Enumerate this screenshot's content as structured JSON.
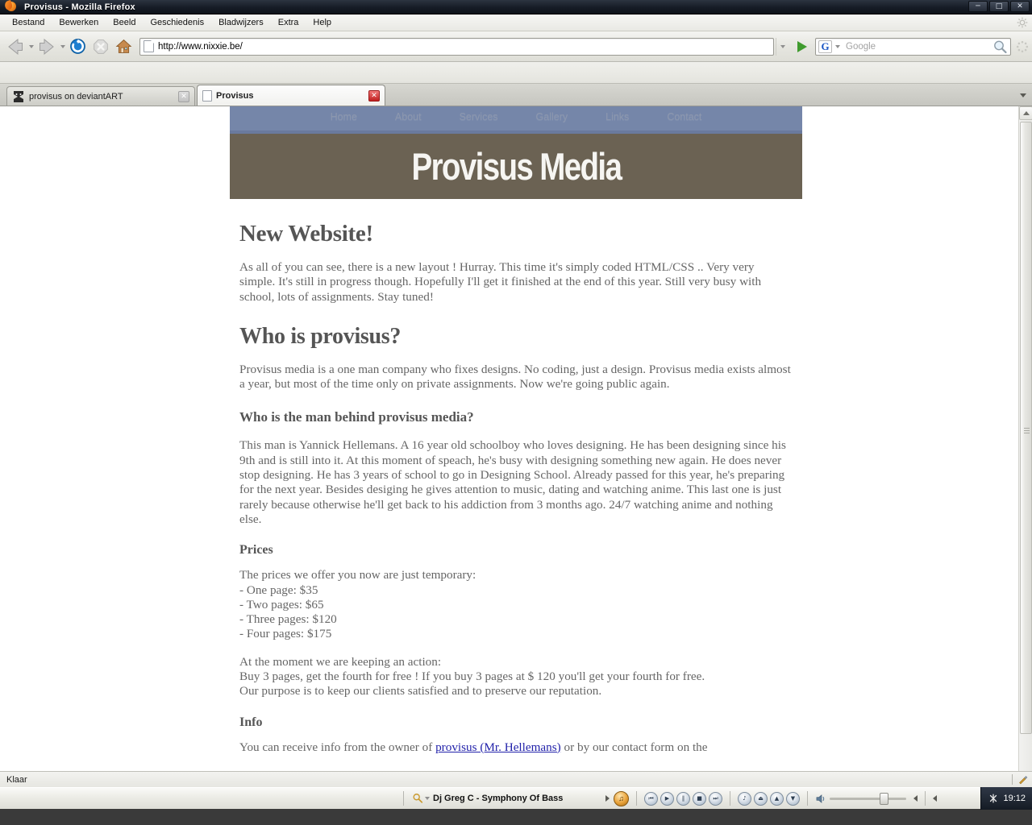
{
  "browser": {
    "window_title": "Provisus - Mozilla Firefox",
    "window_controls": {
      "minimize": "─",
      "maximize": "□",
      "close": "✕"
    },
    "menu": [
      {
        "label": "Bestand",
        "accel": "B"
      },
      {
        "label": "Bewerken",
        "accel": "w"
      },
      {
        "label": "Beeld",
        "accel": "l"
      },
      {
        "label": "Geschiedenis",
        "accel": "G"
      },
      {
        "label": "Bladwijzers",
        "accel": "d"
      },
      {
        "label": "Extra",
        "accel": "x"
      },
      {
        "label": "Help",
        "accel": "H"
      }
    ],
    "toolbar": {
      "back_label": "Back",
      "forward_label": "Forward",
      "reload_label": "Reload",
      "stop_label": "Stop",
      "home_label": "Home",
      "url_value": "http://www.nixxie.be/",
      "url_placeholder": "",
      "go_label": "Go",
      "search_placeholder": "Google",
      "search_value": "",
      "search_engine": "G"
    },
    "tabs": [
      {
        "label": "provisus on deviantART",
        "icon": "deviantart-icon",
        "active": false,
        "close": "✕"
      },
      {
        "label": "Provisus",
        "icon": "page-icon",
        "active": true,
        "close": "✕"
      }
    ],
    "status": {
      "text": "Klaar"
    }
  },
  "site": {
    "nav": [
      {
        "label": "Home"
      },
      {
        "label": "About"
      },
      {
        "label": "Services"
      },
      {
        "label": "Gallery"
      },
      {
        "label": "Links"
      },
      {
        "label": "Contact"
      }
    ],
    "title": "Provisus Media",
    "sections": {
      "h1": "New Website!",
      "intro": "As all of you can see, there is a new layout ! Hurray. This time it's simply coded HTML/CSS .. Very very simple. It's still in progress though. Hopefully I'll get it finished at the end of this year. Still very busy with school, lots of assignments. Stay tuned!",
      "h2_who": "Who is provisus?",
      "who_body": "Provisus media is a one man company who fixes designs. No coding, just a design. Provisus media exists almost a year, but most of the time only on private assignments. Now we're going public again.",
      "h3_man": "Who is the man behind provisus media?",
      "man_body": "This man is Yannick Hellemans. A 16 year old schoolboy who loves designing. He has been designing since his 9th and is still into it. At this moment of speach, he's busy with designing something new again. He does never stop designing. He has 3 years of school to go in Designing School. Already passed for this year, he's preparing for the next year. Besides desiging he gives attention to music, dating and watching anime. This last one is just rarely because otherwise he'll get back to his addiction from 3 months ago. 24/7 watching anime and nothing else.",
      "h4_prices": "Prices",
      "prices_intro": "The prices we offer you now are just temporary:",
      "price_lines": [
        "- One page: $35",
        "- Two pages: $65",
        "- Three pages: $120",
        "- Four pages: $175"
      ],
      "action_lines": [
        "At the moment we are keeping an action:",
        "Buy 3 pages, get the fourth for free ! If you buy 3 pages at $ 120 you'll get your fourth for free.",
        "Our purpose is to keep our clients satisfied and to preserve our reputation."
      ],
      "h4_info": "Info",
      "info_pre": "You can receive info from the owner of ",
      "info_link": "provisus (Mr. Hellemans)",
      "info_post": " or by our contact form on the"
    }
  },
  "taskbar": {
    "media_title": "Dj Greg C - Symphony Of Bass",
    "controls": [
      {
        "name": "previous",
        "glyph": "⏮"
      },
      {
        "name": "play",
        "glyph": "▶"
      },
      {
        "name": "pause",
        "glyph": "‖"
      },
      {
        "name": "stop",
        "glyph": "■"
      },
      {
        "name": "next",
        "glyph": "⏭"
      },
      {
        "name": "music",
        "glyph": "♪"
      },
      {
        "name": "eject",
        "glyph": "⏏"
      },
      {
        "name": "up",
        "glyph": "▲"
      },
      {
        "name": "down",
        "glyph": "▼"
      }
    ],
    "volume_label": "🔊",
    "clock": "19:12"
  },
  "colors": {
    "site_nav": "#7586a9",
    "site_header": "#6b6253",
    "heading": "#555555",
    "body_text": "#666666",
    "link": "#2222aa",
    "titlebar": "#161c26"
  }
}
